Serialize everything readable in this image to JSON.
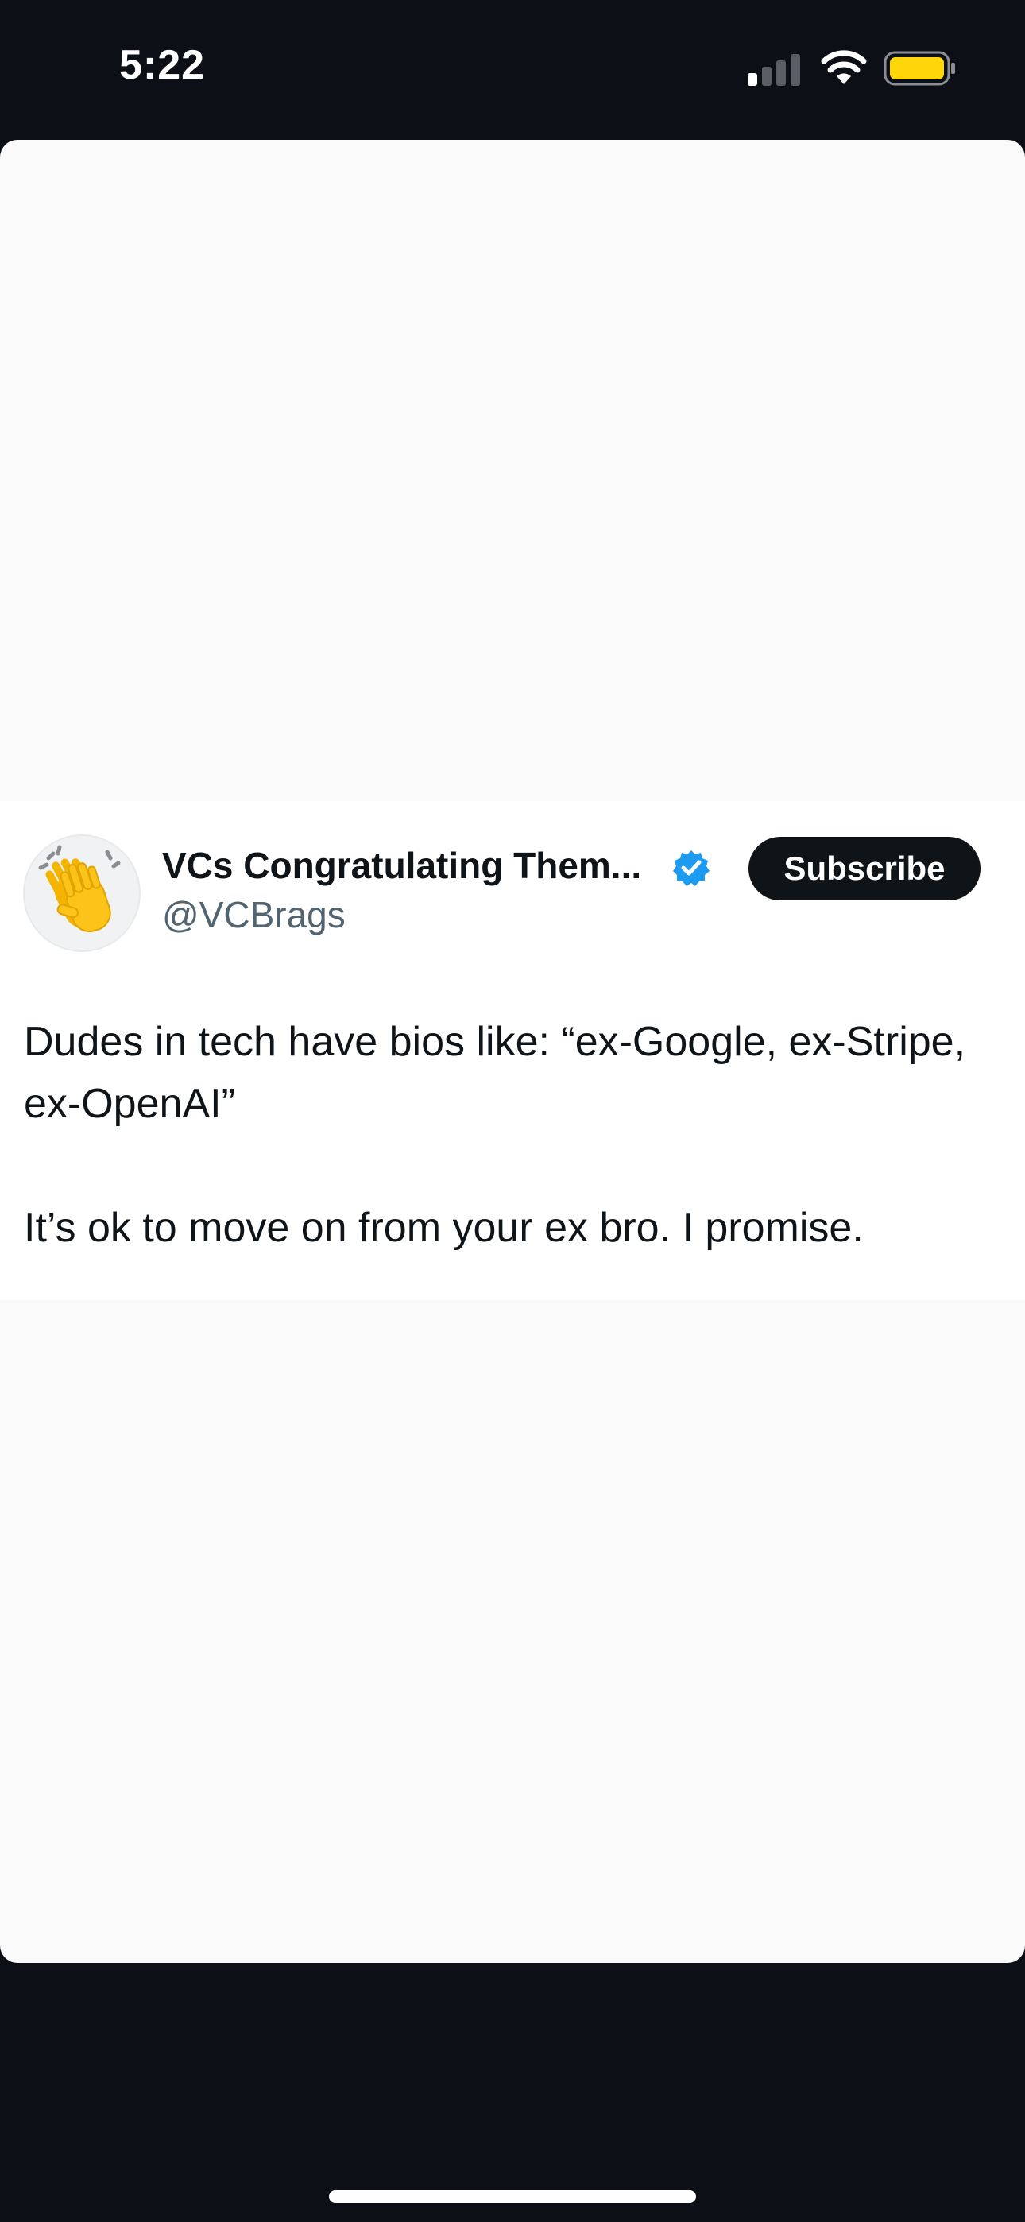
{
  "status_bar": {
    "time": "5:22",
    "signal_icon": "cellular-signal-icon",
    "wifi_icon": "wifi-icon",
    "battery_icon": "battery-icon",
    "battery_color": "#ffd60a"
  },
  "tweet": {
    "avatar_icon": "clapping-hands-icon",
    "display_name": "VCs Congratulating Them...",
    "verified_icon": "verified-badge-icon",
    "verified_color": "#1d9bf0",
    "handle": "@VCBrags",
    "subscribe_label": "Subscribe",
    "text_line_1": "Dudes in tech have bios like: “ex-Google, ex-Stripe, ex-OpenAI”",
    "text_line_2": "It’s ok to move on from your ex bro. I promise."
  }
}
